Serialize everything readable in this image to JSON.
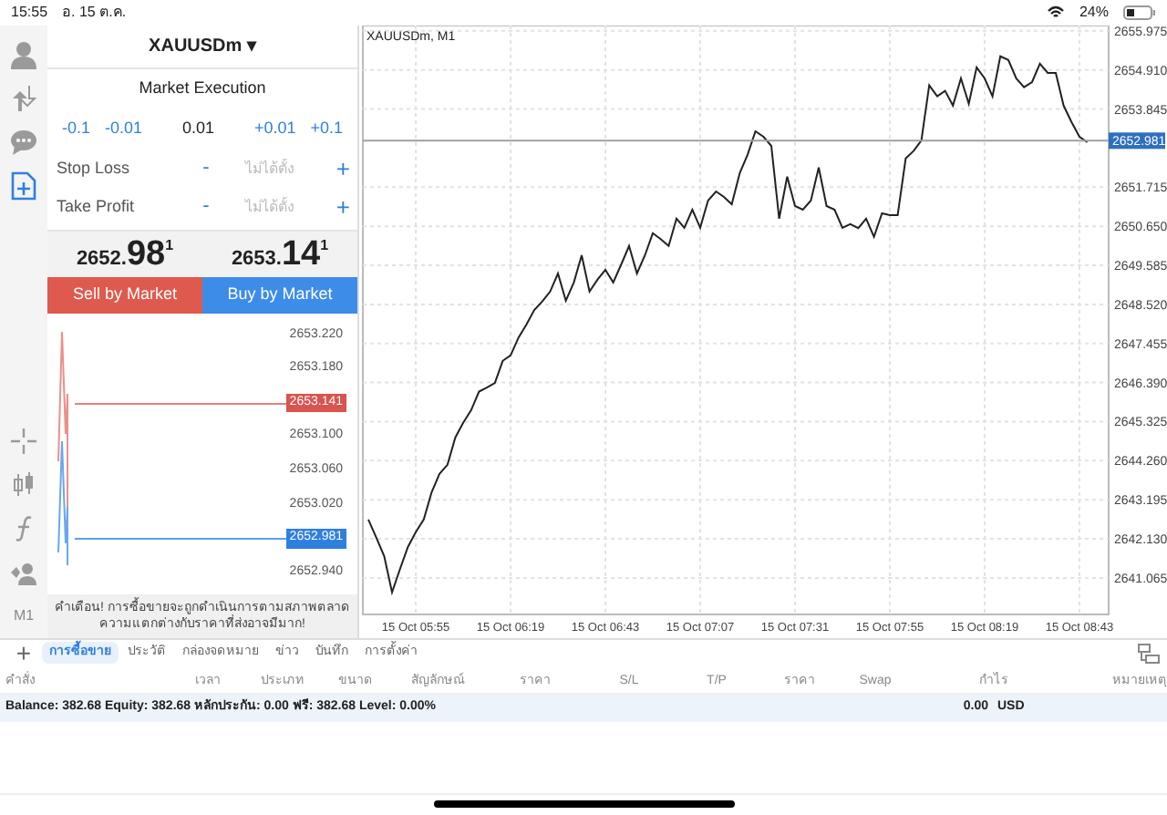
{
  "status_bar": {
    "time": "15:55",
    "date": "อ. 15 ต.ค.",
    "battery": "24%"
  },
  "rail": {
    "top": [
      {
        "kind": "account",
        "selected": false
      },
      {
        "kind": "trade",
        "selected": false
      },
      {
        "kind": "chat",
        "selected": false
      },
      {
        "kind": "new_order",
        "selected": true
      }
    ],
    "bottom": [
      {
        "kind": "crosshair"
      },
      {
        "kind": "candles"
      },
      {
        "kind": "indicators"
      },
      {
        "kind": "objects"
      },
      {
        "kind": "timeframe",
        "label": "M1"
      }
    ]
  },
  "order": {
    "symbol": "XAUUSDm",
    "symbol_caret": "▾",
    "execution": "Market Execution",
    "volume": {
      "decrease": [
        "-0.1",
        "-0.01"
      ],
      "value": "0.01",
      "increase": [
        "+0.01",
        "+0.1"
      ]
    },
    "fields": [
      {
        "label": "Stop Loss",
        "minus": "-",
        "placeholder": "ไม่ได้ตั้ง",
        "plus": "+"
      },
      {
        "label": "Take Profit",
        "minus": "-",
        "placeholder": "ไม่ได้ตั้ง",
        "plus": "+"
      }
    ],
    "bid": {
      "prefix": "2652.",
      "big": "98",
      "suffix": "1"
    },
    "ask": {
      "prefix": "2653.",
      "big": "14",
      "suffix": "1"
    },
    "sell_button": "Sell by Market",
    "buy_button": "Buy by Market",
    "tick_levels": [
      {
        "label": "2653.220",
        "kind": "level"
      },
      {
        "label": "2653.180",
        "kind": "level"
      },
      {
        "label": "2653.141",
        "kind": "ask"
      },
      {
        "label": "2653.100",
        "kind": "level"
      },
      {
        "label": "2653.060",
        "kind": "level"
      },
      {
        "label": "2653.020",
        "kind": "level"
      },
      {
        "label": "2652.981",
        "kind": "bid"
      },
      {
        "label": "2652.940",
        "kind": "level"
      }
    ],
    "warning": "คำเตือน! การซื้อขายจะถูกดำเนินการตามสภาพตลาด ความแตกต่างกับราคาที่ส่งอาจมีมาก!"
  },
  "chart": {
    "chart_data": {
      "type": "line",
      "title": "XAUUSDm, M1",
      "categories": [
        null,
        null,
        null,
        null,
        null,
        null,
        "15 Oct 05:55",
        null,
        null,
        null,
        null,
        null,
        null,
        null,
        null,
        null,
        null,
        null,
        "15 Oct 06:19",
        null,
        null,
        null,
        null,
        null,
        null,
        null,
        null,
        null,
        null,
        null,
        "15 Oct 06:43",
        null,
        null,
        null,
        null,
        null,
        null,
        null,
        null,
        null,
        null,
        null,
        "15 Oct 07:07",
        null,
        null,
        null,
        null,
        null,
        null,
        null,
        null,
        null,
        null,
        null,
        "15 Oct 07:31",
        null,
        null,
        null,
        null,
        null,
        null,
        null,
        null,
        null,
        null,
        null,
        "15 Oct 07:55",
        null,
        null,
        null,
        null,
        null,
        null,
        null,
        null,
        null,
        null,
        null,
        "15 Oct 08:19",
        null,
        null,
        null,
        null,
        null,
        null,
        null,
        null,
        null,
        null,
        null,
        "15 Oct 08:43",
        null
      ],
      "series": [
        {
          "color": "#222222",
          "values": [
            2642.66,
            2642.16,
            2641.66,
            2640.67,
            2641.31,
            2641.91,
            2642.31,
            2642.66,
            2643.4,
            2643.9,
            2644.15,
            2644.89,
            2645.29,
            2645.64,
            2646.14,
            2646.25,
            2646.38,
            2646.98,
            2647.13,
            2647.62,
            2647.97,
            2648.37,
            2648.6,
            2648.87,
            2649.36,
            2648.62,
            2649.12,
            2649.86,
            2648.87,
            2649.2,
            2649.46,
            2649.12,
            2649.61,
            2650.11,
            2649.36,
            2649.86,
            2650.46,
            2650.3,
            2650.11,
            2650.86,
            2650.61,
            2651.1,
            2650.61,
            2651.35,
            2651.6,
            2651.45,
            2651.25,
            2652.1,
            2652.6,
            2653.24,
            2653.09,
            2652.84,
            2650.86,
            2652.0,
            2651.2,
            2651.1,
            2651.35,
            2652.25,
            2651.2,
            2651.1,
            2650.61,
            2650.71,
            2650.6,
            2650.86,
            2650.36,
            2651.0,
            2650.95,
            2650.95,
            2652.5,
            2652.7,
            2652.99,
            2654.49,
            2654.19,
            2654.34,
            2653.94,
            2654.68,
            2653.99,
            2654.98,
            2654.68,
            2654.19,
            2655.28,
            2655.18,
            2654.68,
            2654.44,
            2654.58,
            2655.08,
            2654.83,
            2654.83,
            2653.94,
            2653.49,
            2653.09,
            2652.94
          ]
        }
      ],
      "ylim": [
        2640.07,
        2656.12
      ],
      "grid": true,
      "ref_lines": [
        {
          "axis": "y",
          "value": 2652.981
        }
      ],
      "yticks": [
        {
          "value": 2655.975,
          "label": "2655.975"
        },
        {
          "value": 2654.91,
          "label": "2654.910"
        },
        {
          "value": 2653.845,
          "label": "2653.845"
        },
        {
          "value": 2651.715,
          "label": "2651.715"
        },
        {
          "value": 2650.65,
          "label": "2650.650"
        },
        {
          "value": 2649.585,
          "label": "2649.585"
        },
        {
          "value": 2648.52,
          "label": "2648.520"
        },
        {
          "value": 2647.455,
          "label": "2647.455"
        },
        {
          "value": 2646.39,
          "label": "2646.390"
        },
        {
          "value": 2645.325,
          "label": "2645.325"
        },
        {
          "value": 2644.26,
          "label": "2644.260"
        },
        {
          "value": 2643.195,
          "label": "2643.195"
        },
        {
          "value": 2642.13,
          "label": "2642.130"
        },
        {
          "value": 2641.065,
          "label": "2641.065"
        }
      ]
    },
    "price_tag": "2652.981"
  },
  "toolbox": {
    "add": "+",
    "tabs": [
      {
        "label": "การซื้อขาย",
        "selected": true
      },
      {
        "label": "ประวัติ",
        "selected": false
      },
      {
        "label": "กล่องจดหมาย",
        "selected": false
      },
      {
        "label": "ข่าว",
        "selected": false
      },
      {
        "label": "บันทึก",
        "selected": false
      },
      {
        "label": "การตั้งค่า",
        "selected": false
      }
    ],
    "columns": [
      "คำสั่ง",
      "เวลา",
      "ประเภท",
      "ขนาด",
      "สัญลักษณ์",
      "ราคา",
      "S/L",
      "T/P",
      "ราคา",
      "Swap",
      "กำไร",
      "หมายเหตุ"
    ],
    "balance": "Balance: 382.68 Equity: 382.68 หลักประกัน: 0.00 ฟรี: 382.68 Level: 0.00%",
    "profit": "0.00",
    "currency": "USD"
  }
}
